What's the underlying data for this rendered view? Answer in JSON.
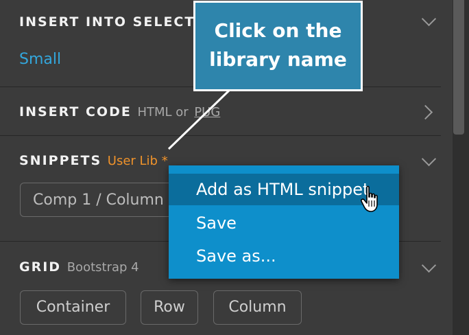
{
  "callout": {
    "line1": "Click on the",
    "line2": "library name"
  },
  "sections": {
    "insert_into_selection": {
      "title": "INSERT INTO SELECTI",
      "value": "Small"
    },
    "insert_code": {
      "title": "INSERT CODE",
      "sub_html": "HTML or",
      "sub_pug": "PUG"
    },
    "snippets": {
      "title": "SNIPPETS",
      "library": "User Lib *",
      "input_value": "Comp 1 / Column"
    },
    "grid": {
      "title": "GRID",
      "sub": "Bootstrap 4",
      "buttons": [
        "Container",
        "Row",
        "Column"
      ]
    }
  },
  "context_menu": {
    "items": [
      "Add as HTML snippet",
      "Save",
      "Save as..."
    ],
    "highlighted_index": 0
  },
  "colors": {
    "panel_bg": "#3b3b3b",
    "link_blue": "#33a7dd",
    "orange": "#f0932b",
    "menu_bg": "#0e8fcb",
    "menu_highlight": "#0b6d9c",
    "callout_bg": "#2e85ac"
  },
  "icons": {
    "collapse": "chevron-down-icon",
    "expand": "chevron-right-icon",
    "pointer": "hand-pointer-icon"
  }
}
